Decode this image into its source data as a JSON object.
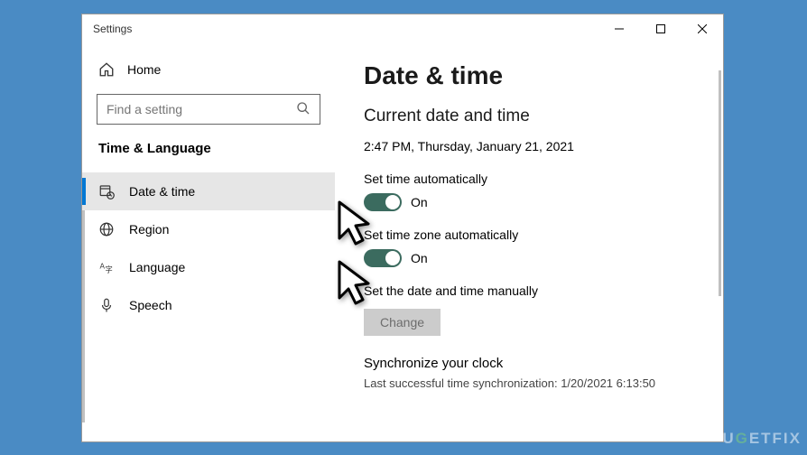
{
  "window": {
    "title": "Settings"
  },
  "sidebar": {
    "home_label": "Home",
    "search_placeholder": "Find a setting",
    "category": "Time & Language",
    "items": [
      {
        "label": "Date & time"
      },
      {
        "label": "Region"
      },
      {
        "label": "Language"
      },
      {
        "label": "Speech"
      }
    ]
  },
  "main": {
    "title": "Date & time",
    "section_current": "Current date and time",
    "current_datetime": "2:47 PM, Thursday, January 21, 2021",
    "set_time_auto_label": "Set time automatically",
    "set_time_auto_state": "On",
    "set_tz_auto_label": "Set time zone automatically",
    "set_tz_auto_state": "On",
    "manual_label": "Set the date and time manually",
    "change_button": "Change",
    "sync_header": "Synchronize your clock",
    "sync_status": "Last successful time synchronization: 1/20/2021 6:13:50"
  },
  "watermark": "UGETFIX"
}
